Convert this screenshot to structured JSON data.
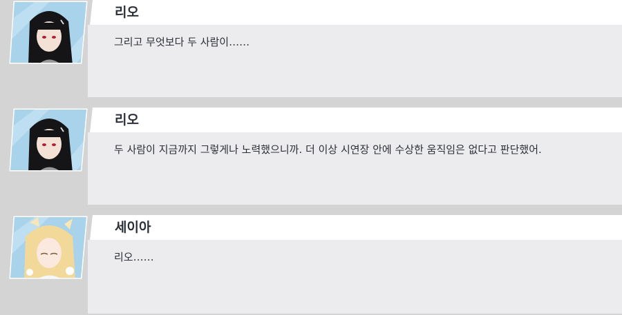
{
  "messages": [
    {
      "speaker": "리오",
      "text": "그리고 무엇보다 두 사람이……",
      "avatar_icon": "rio-portrait-icon"
    },
    {
      "speaker": "리오",
      "text": "두 사람이 지금까지 그렇게나 노력했으니까. 더 이상 시연장 안에 수상한 움직임은 없다고 판단했어.",
      "avatar_icon": "rio-portrait-icon"
    },
    {
      "speaker": "세이아",
      "text": "리오……",
      "avatar_icon": "seia-portrait-icon"
    }
  ],
  "colors": {
    "background": "#d4d4d4",
    "name_bar": "#ffffff",
    "bubble": "#ececee",
    "text": "#2b2f37",
    "avatar_bg": "#a9d3ea"
  }
}
